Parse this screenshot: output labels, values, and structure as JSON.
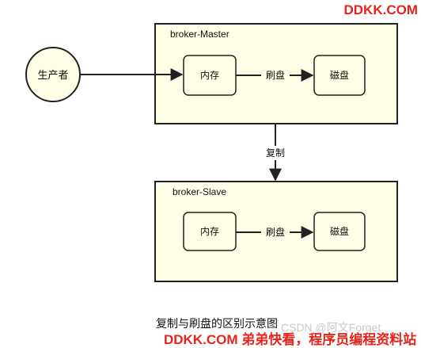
{
  "diagram": {
    "producer": "生产者",
    "master": {
      "title": "broker-Master",
      "memory": "内存",
      "flush": "刷盘",
      "disk": "磁盘"
    },
    "replicate": "复制",
    "slave": {
      "title": "broker-Slave",
      "memory": "内存",
      "flush": "刷盘",
      "disk": "磁盘"
    },
    "caption": "复制与刷盘的区别示意图"
  },
  "watermarks": {
    "top": "DDKK.COM",
    "bottom": "DDKK.COM 弟弟快看，程序员编程资料站",
    "csdn": "CSDN @阿文Forget"
  },
  "colors": {
    "box_fill": "#fefee6",
    "stroke": "#222222",
    "watermark": "#e5241b"
  }
}
